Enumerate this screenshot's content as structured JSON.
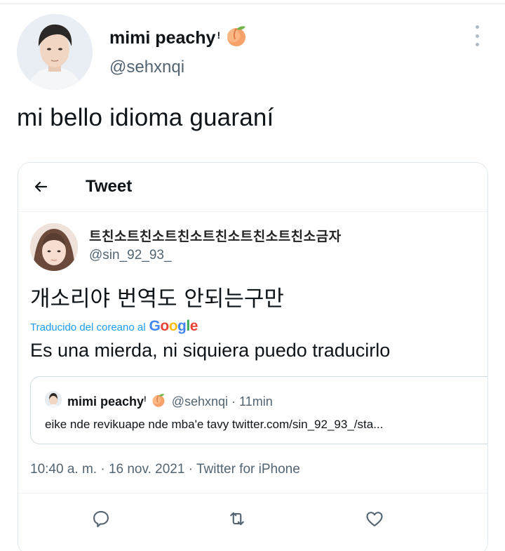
{
  "tweet": {
    "display_name": "mimi peachy",
    "name_mark": "!",
    "name_emoji": "peach-emoji",
    "handle": "@sehxnqi",
    "text": "mi bello idioma guaraní",
    "menu_icon": "more-vertical-icon"
  },
  "screenshot": {
    "header": {
      "back_icon": "back-arrow-icon",
      "title": "Tweet"
    },
    "author": {
      "name": "트친소트친소트친소트친소트친소트친소금자",
      "handle": "@sin_92_93_"
    },
    "original_text": "개소리야 번역도 안되는구만",
    "translation_label": "Traducido del coreano al",
    "translation_provider": "Google",
    "translation": "Es una mierda, ni siquiera puedo traducirlo",
    "quote": {
      "name": "mimi peachy",
      "name_mark": "!",
      "handle": "@sehxnqi",
      "time": "· 11min",
      "text": "eike nde revikuape nde mba'e tavy twitter.com/sin_92_93_/sta..."
    },
    "timestamp": "10:40 a. m. · 16 nov. 2021 · Twitter for iPhone",
    "actions": [
      "reply-icon",
      "retweet-icon",
      "like-icon"
    ]
  },
  "colors": {
    "link": "#1d9bf0",
    "secondary_text": "#536471",
    "google_blue": "#4285f4",
    "google_red": "#ea4335",
    "google_yellow": "#fbbc05",
    "google_green": "#34a853"
  }
}
